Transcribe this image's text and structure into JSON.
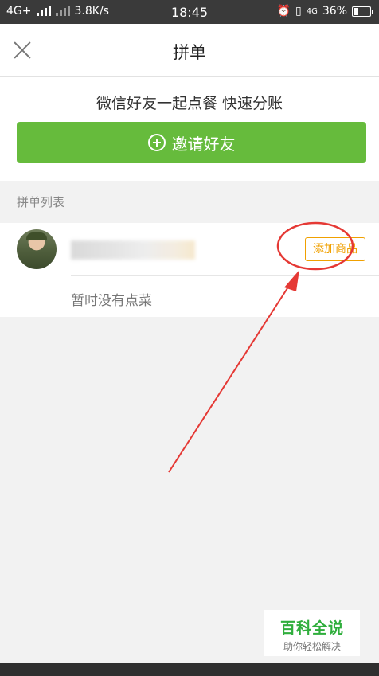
{
  "status_bar": {
    "network": "4G+",
    "speed": "3.8K/s",
    "time": "18:45",
    "network_right": "4G",
    "battery": "36%",
    "battery_level": 0.36
  },
  "header": {
    "title": "拼单",
    "close_icon": "close-icon"
  },
  "invite": {
    "tagline": "微信好友一起点餐 快速分账",
    "button_label": "邀请好友",
    "button_color": "#66bb3c"
  },
  "list": {
    "section_label": "拼单列表",
    "members": [
      {
        "avatar": "avatar",
        "add_button_label": "添加商品",
        "empty_text": "暂时没有点菜"
      }
    ]
  },
  "annotation": {
    "color": "#e53935"
  },
  "watermark": {
    "title": "百科全说",
    "subtitle": "助你轻松解决"
  }
}
